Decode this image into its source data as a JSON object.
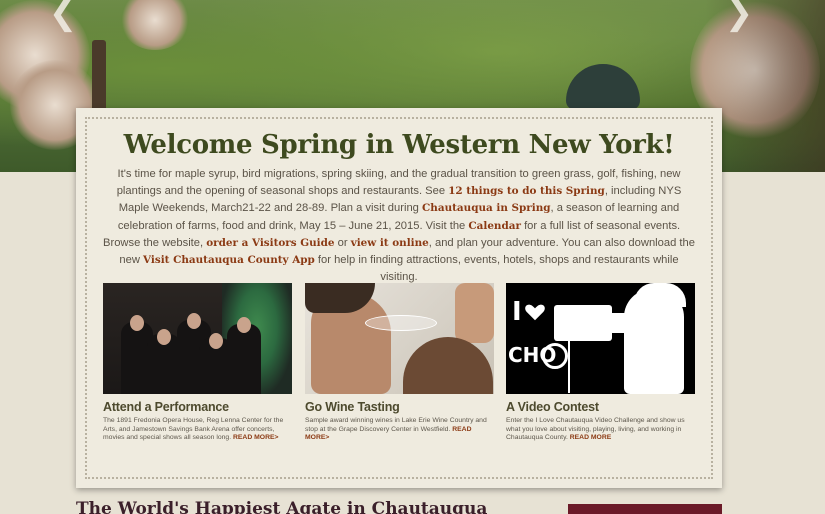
{
  "hero": {
    "prev_arrow": "❮",
    "next_arrow": "❯"
  },
  "card": {
    "title": "Welcome Spring in Western New York!",
    "intro": {
      "t1": "It's time for maple syrup, bird migrations, spring skiing, and the gradual transition to green grass, golf, fishing, new plantings and the opening of seasonal shops and restaurants. See ",
      "l1": "12 things to do this Spring",
      "t2": ", including NYS Maple Weekends, March21-22 and 28-89. Plan a visit during ",
      "l2": "Chautauqua in Spring",
      "t3": ", a season of learning and celebration of farms, food and drink, May 15 – June 21, 2015. Visit the ",
      "l3": "Calendar",
      "t4": " for a full list of seasonal events. Browse the website, ",
      "l4": "order a Visitors Guide",
      "t5": " or ",
      "l5": "view it online",
      "t6": ", and plan your adventure. You can also download the new ",
      "l6": "Visit Chautauqua County App",
      "t7": " for help in finding attractions, events, hotels, shops and restaurants while visiting."
    },
    "features": [
      {
        "title": "Attend a Performance",
        "desc": "The 1891 Fredonia Opera House, Reg Lenna Center for the Arts, and Jamestown Savings Bank Arena offer concerts, movies and special shows all season long. ",
        "more": "READ MORE>"
      },
      {
        "title": "Go Wine Tasting",
        "desc": "Sample award winning wines in Lake Erie Wine Country and stop at the Grape Discovery Center in Westfield. ",
        "more": "READ MORE>"
      },
      {
        "title": "A Video Contest",
        "desc": "Enter the I Love Chautauqua Video Challenge and show us what you love about visiting, playing, living, and working in Chautauqua County. ",
        "more": "READ MORE"
      }
    ],
    "video_photo_text": {
      "i": "I",
      "cho": "CHO"
    }
  },
  "bottom": {
    "heading": "The World's Happiest Agate in Chautauqua"
  }
}
